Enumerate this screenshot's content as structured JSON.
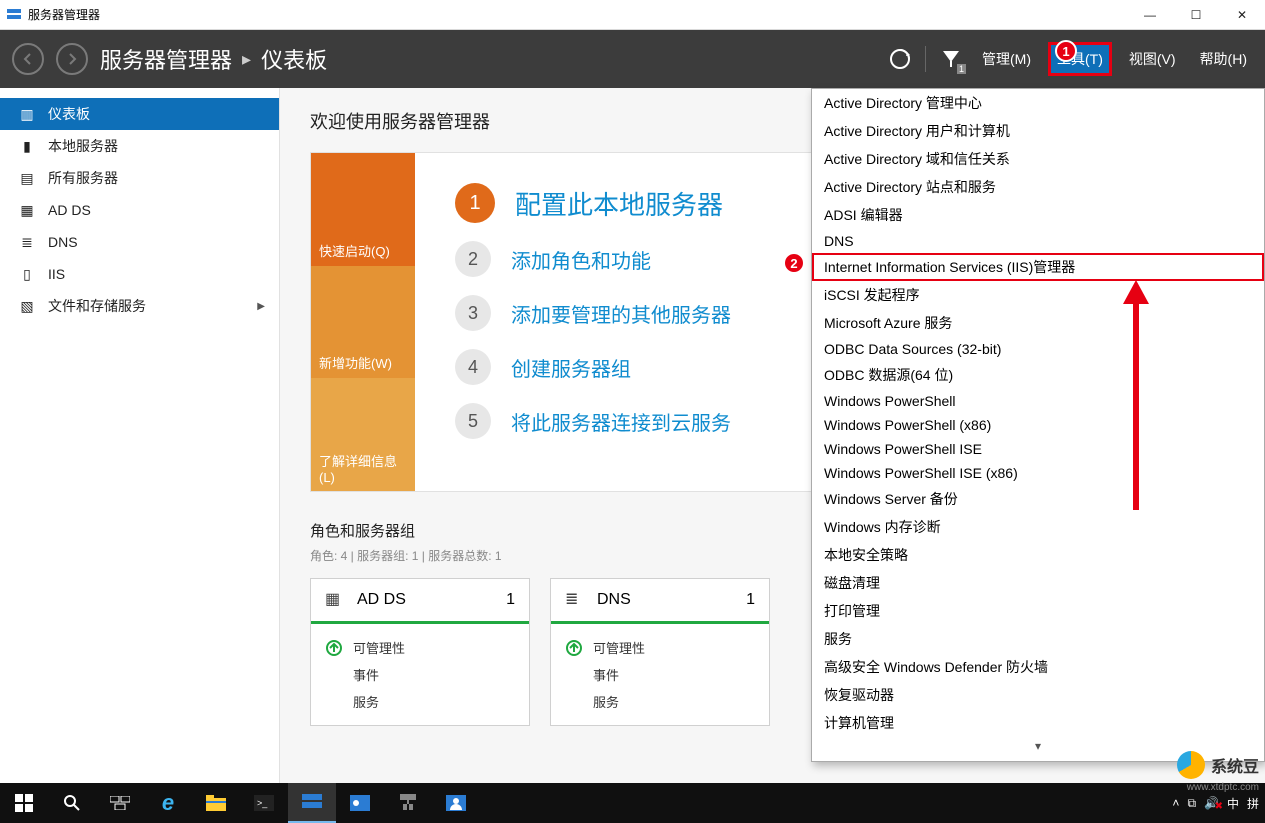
{
  "title": "服务器管理器",
  "breadcrumb": {
    "app": "服务器管理器",
    "page": "仪表板"
  },
  "menus": {
    "manage": "管理(M)",
    "tools": "工具(T)",
    "view": "视图(V)",
    "help": "帮助(H)"
  },
  "sidebar": {
    "items": [
      {
        "label": "仪表板"
      },
      {
        "label": "本地服务器"
      },
      {
        "label": "所有服务器"
      },
      {
        "label": "AD DS"
      },
      {
        "label": "DNS"
      },
      {
        "label": "IIS"
      },
      {
        "label": "文件和存储服务"
      }
    ]
  },
  "welcome": {
    "title": "欢迎使用服务器管理器",
    "left": {
      "quick": "快速启动(Q)",
      "new": "新增功能(W)",
      "learn": "了解详细信息(L)"
    },
    "steps": [
      "配置此本地服务器",
      "添加角色和功能",
      "添加要管理的其他服务器",
      "创建服务器组",
      "将此服务器连接到云服务"
    ]
  },
  "roles": {
    "heading": "角色和服务器组",
    "sub": "角色: 4 | 服务器组: 1 | 服务器总数: 1",
    "cards": [
      {
        "name": "AD DS",
        "count": "1",
        "rows": [
          "可管理性",
          "事件",
          "服务"
        ]
      },
      {
        "name": "DNS",
        "count": "1",
        "rows": [
          "可管理性",
          "事件",
          "服务"
        ]
      }
    ]
  },
  "tools_menu": [
    "Active Directory 管理中心",
    "Active Directory 用户和计算机",
    "Active Directory 域和信任关系",
    "Active Directory 站点和服务",
    "ADSI 编辑器",
    "DNS",
    "Internet Information Services (IIS)管理器",
    "iSCSI 发起程序",
    "Microsoft Azure 服务",
    "ODBC Data Sources (32-bit)",
    "ODBC 数据源(64 位)",
    "Windows PowerShell",
    "Windows PowerShell (x86)",
    "Windows PowerShell ISE",
    "Windows PowerShell ISE (x86)",
    "Windows Server 备份",
    "Windows 内存诊断",
    "本地安全策略",
    "磁盘清理",
    "打印管理",
    "服务",
    "高级安全 Windows Defender 防火墙",
    "恢复驱动器",
    "计算机管理"
  ],
  "annotations": {
    "one": "1",
    "two": "2"
  },
  "taskbar": {
    "ime1": "中",
    "ime2": "拼"
  },
  "watermark": {
    "name": "系统豆",
    "url": "www.xtdptc.com"
  }
}
